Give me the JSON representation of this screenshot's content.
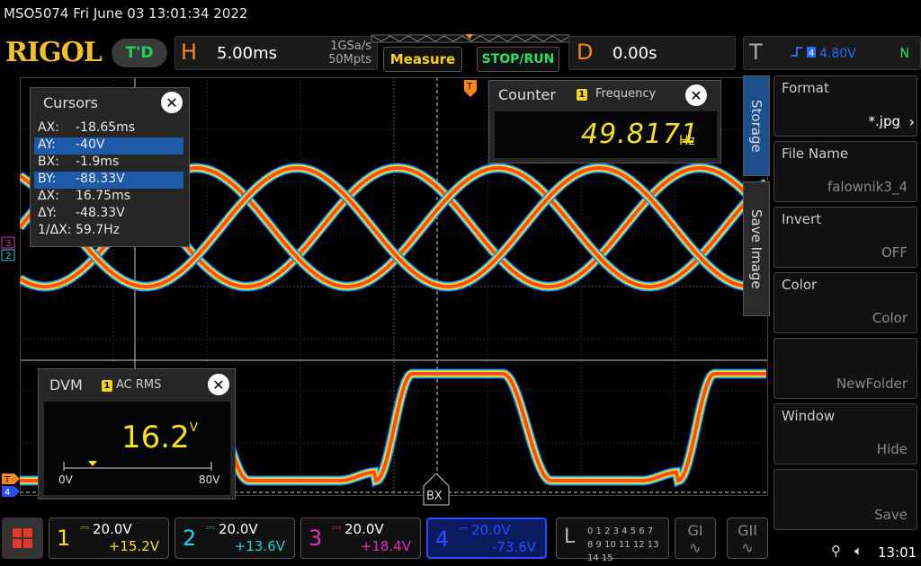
{
  "status_line": "MSO5074  Fri June 03 13:01:34 2022",
  "brand": {
    "logo": "RIGOL",
    "mode_badge": "T'D"
  },
  "horizontal": {
    "letter": "H",
    "timebase": "5.00ms",
    "sample_rate": "1GSa/s",
    "memory_depth": "50Mpts"
  },
  "buttons": {
    "measure": "Measure",
    "stop_run": "STOP/RUN"
  },
  "delay": {
    "letter": "D",
    "value": "0.00s"
  },
  "trigger": {
    "letter": "T",
    "level": "4.80V",
    "mode": "N"
  },
  "cursors": {
    "title": "Cursors",
    "rows": [
      {
        "key": "AX:",
        "value": "-18.65ms",
        "selected": false
      },
      {
        "key": "AY:",
        "value": "-40V",
        "selected": true
      },
      {
        "key": "BX:",
        "value": "-1.9ms",
        "selected": false
      },
      {
        "key": "BY:",
        "value": "-88.33V",
        "selected": true
      },
      {
        "key": "ΔX:",
        "value": "16.75ms",
        "selected": false
      },
      {
        "key": "ΔY:",
        "value": "-48.33V",
        "selected": false
      },
      {
        "key": "1/ΔX:",
        "value": "59.7Hz",
        "selected": false
      }
    ],
    "bx_label": "BX"
  },
  "counter": {
    "title": "Counter",
    "channel": "1",
    "mode": "Frequency",
    "value": "49.8171",
    "unit": "Hz"
  },
  "dvm": {
    "title": "DVM",
    "channel": "1",
    "mode": "AC RMS",
    "value": "16.2",
    "unit": "V",
    "scale_min": "0V",
    "scale_max": "80V"
  },
  "side_tabs": [
    "Storage",
    "Save Image"
  ],
  "menu": [
    {
      "label": "Format",
      "value": ".jpg",
      "prefix": "*",
      "arrow": true
    },
    {
      "label": "File Name",
      "value": "falownik3_4"
    },
    {
      "label": "Invert",
      "value": "OFF"
    },
    {
      "label": "Color",
      "value": "Color"
    },
    {
      "label": "",
      "value": "NewFolder"
    },
    {
      "label": "Window",
      "value": "Hide"
    },
    {
      "label": "",
      "value": "Save"
    }
  ],
  "channels": [
    {
      "num": "1",
      "scale": "20.0V",
      "offset": "+15.2V",
      "color": "#f6e11a"
    },
    {
      "num": "2",
      "scale": "20.0V",
      "offset": "+13.6V",
      "color": "#22d0e0"
    },
    {
      "num": "3",
      "scale": "20.0V",
      "offset": "+18.4V",
      "color": "#e02fb8"
    },
    {
      "num": "4",
      "scale": "20.0V",
      "offset": "-73.6V",
      "color": "#2a4cff"
    }
  ],
  "logic": {
    "letter": "L",
    "row1": "0 1 2 3  4 5 6 7",
    "row2": "8 9 10 11 12 13 14 15"
  },
  "generators": [
    "GI",
    "GII"
  ],
  "clock": "13:01",
  "colors": {
    "logo": "#f2c02a",
    "accent_orange": "#f7861c",
    "trace_red": "#ff4a1a"
  }
}
